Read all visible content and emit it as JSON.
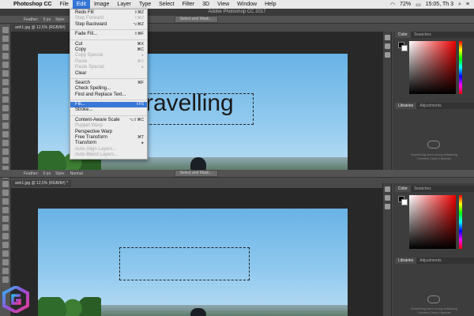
{
  "menubar": {
    "apple": "",
    "items": [
      "Photoshop CC",
      "File",
      "Edit",
      "Image",
      "Layer",
      "Type",
      "Select",
      "Filter",
      "3D",
      "View",
      "Window",
      "Help"
    ],
    "active_index": 2,
    "status": {
      "battery": "72%",
      "clock": "15:05, Th 3"
    }
  },
  "window_top": {
    "title": "Adobe Photoshop CC 2017",
    "tab": "anh1.jpg @ 12,5% (RGB/8#)",
    "options": {
      "feather_label": "Feather:",
      "feather_value": "0 px",
      "style_label": "Style:",
      "style_value": "Normal",
      "select_mask": "Select and Mask..."
    },
    "canvas_text": "ravelling"
  },
  "window_bottom": {
    "tab": "anh1.jpg @ 12,5% (RGB/8#) *"
  },
  "panels": {
    "color_tab": "Color",
    "swatches_tab": "Swatches",
    "libraries_tab": "Libraries",
    "adjustments_tab": "Adjustments",
    "lib_message_1": "Something went wrong initializing",
    "lib_message_2": "Creative Cloud Libraries"
  },
  "edit_menu": [
    {
      "label": "Redo Fill",
      "shortcut": "⇧⌘Z",
      "disabled": false
    },
    {
      "label": "Step Forward",
      "shortcut": "⇧⌘Z",
      "disabled": true
    },
    {
      "label": "Step Backward",
      "shortcut": "⌥⌘Z",
      "disabled": false
    },
    {
      "sep": true
    },
    {
      "label": "Fade Fill...",
      "shortcut": "⇧⌘F",
      "disabled": false
    },
    {
      "sep": true
    },
    {
      "label": "Cut",
      "shortcut": "⌘X",
      "disabled": false
    },
    {
      "label": "Copy",
      "shortcut": "⌘C",
      "disabled": false
    },
    {
      "label": "Copy Special",
      "shortcut": "▸",
      "disabled": true
    },
    {
      "label": "Paste",
      "shortcut": "⌘V",
      "disabled": true
    },
    {
      "label": "Paste Special",
      "shortcut": "▸",
      "disabled": true
    },
    {
      "label": "Clear",
      "shortcut": "",
      "disabled": false
    },
    {
      "sep": true
    },
    {
      "label": "Search",
      "shortcut": "⌘F",
      "disabled": false
    },
    {
      "label": "Check Spelling...",
      "shortcut": "",
      "disabled": false
    },
    {
      "label": "Find and Replace Text...",
      "shortcut": "",
      "disabled": false
    },
    {
      "sep": true
    },
    {
      "label": "Fill...",
      "shortcut": "⇧F5",
      "disabled": false,
      "highlight": true
    },
    {
      "label": "Stroke...",
      "shortcut": "",
      "disabled": false
    },
    {
      "sep": true
    },
    {
      "label": "Content-Aware Scale",
      "shortcut": "⌥⇧⌘C",
      "disabled": false
    },
    {
      "label": "Puppet Warp",
      "shortcut": "",
      "disabled": true
    },
    {
      "label": "Perspective Warp",
      "shortcut": "",
      "disabled": false
    },
    {
      "label": "Free Transform",
      "shortcut": "⌘T",
      "disabled": false
    },
    {
      "label": "Transform",
      "shortcut": "▸",
      "disabled": false
    },
    {
      "label": "Auto-Align Layers...",
      "shortcut": "",
      "disabled": true
    },
    {
      "label": "Auto-Blend Layers...",
      "shortcut": "",
      "disabled": true
    }
  ],
  "colors": {
    "menu_highlight": "#3a78d8",
    "ps_bg": "#4a4a4a"
  }
}
